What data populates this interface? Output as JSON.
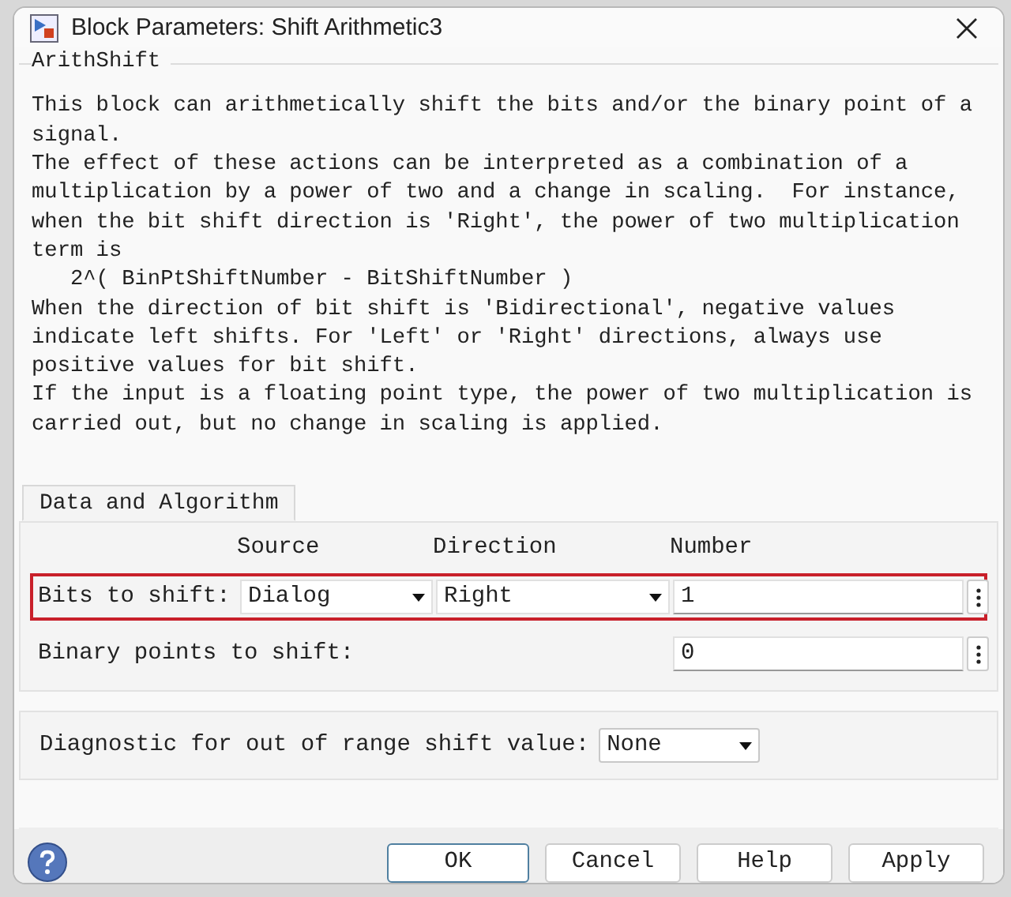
{
  "window": {
    "title": "Block Parameters: Shift Arithmetic3"
  },
  "group": {
    "title": "ArithShift",
    "paragraphs": [
      "This block can arithmetically shift the bits and/or the binary point of a\nsignal.",
      "The effect of these actions can be interpreted as a combination of a\nmultiplication by a power of two and a change in scaling.  For instance,\nwhen the bit shift direction is 'Right', the power of two multiplication\nterm is",
      "   2^( BinPtShiftNumber - BitShiftNumber )",
      "When the direction of bit shift is 'Bidirectional', negative values\nindicate left shifts. For 'Left' or 'Right' directions, always use\npositive values for bit shift.",
      "If the input is a floating point type, the power of two multiplication is\ncarried out, but no change in scaling is applied."
    ]
  },
  "tabs": [
    {
      "label": "Data and Algorithm",
      "selected": true
    }
  ],
  "columns": [
    "Source",
    "Direction",
    "Number"
  ],
  "bits_row": {
    "label": "Bits to shift:",
    "source": "Dialog",
    "direction": "Right",
    "number": "1",
    "highlighted": true
  },
  "binary_row": {
    "label": "Binary points to shift:",
    "number": "0"
  },
  "diagnostic": {
    "label": "Diagnostic for out of range shift value:",
    "value": "None"
  },
  "buttons": [
    {
      "label": "OK",
      "default": true
    },
    {
      "label": "Cancel",
      "default": false
    },
    {
      "label": "Help",
      "default": false
    },
    {
      "label": "Apply",
      "default": false
    }
  ]
}
